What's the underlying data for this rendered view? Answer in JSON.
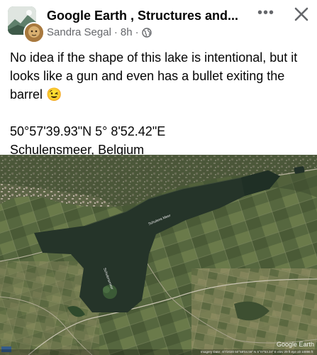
{
  "post": {
    "group_name": "Google  Earth , Structures and...",
    "author": "Sandra Segal",
    "time": "8h",
    "separator": "·",
    "privacy_icon": "globe-icon",
    "more_label": "•••",
    "close_icon": "close-icon",
    "text_line1": "No idea if the shape of this lake is intentional, but it looks like a gun and even has a bullet exiting the barrel 😉",
    "coordinates": "50°57'39.93\"N  5° 8'52.42\"E",
    "location": "Schulensmeer, Belgium"
  },
  "photo": {
    "lake_label_1": "Schulens Meer",
    "lake_label_2": "Schulensmeer",
    "watermark": "Google Earth",
    "imagery_line": "Imagery Date: 4/7/2020   50°58'04.56\" N   5°07'53.34\" E   elev   29 ft   eye alt 10896 ft"
  },
  "colors": {
    "water": "#24352a",
    "fields": "#55663f",
    "text_secondary": "#65676b"
  }
}
